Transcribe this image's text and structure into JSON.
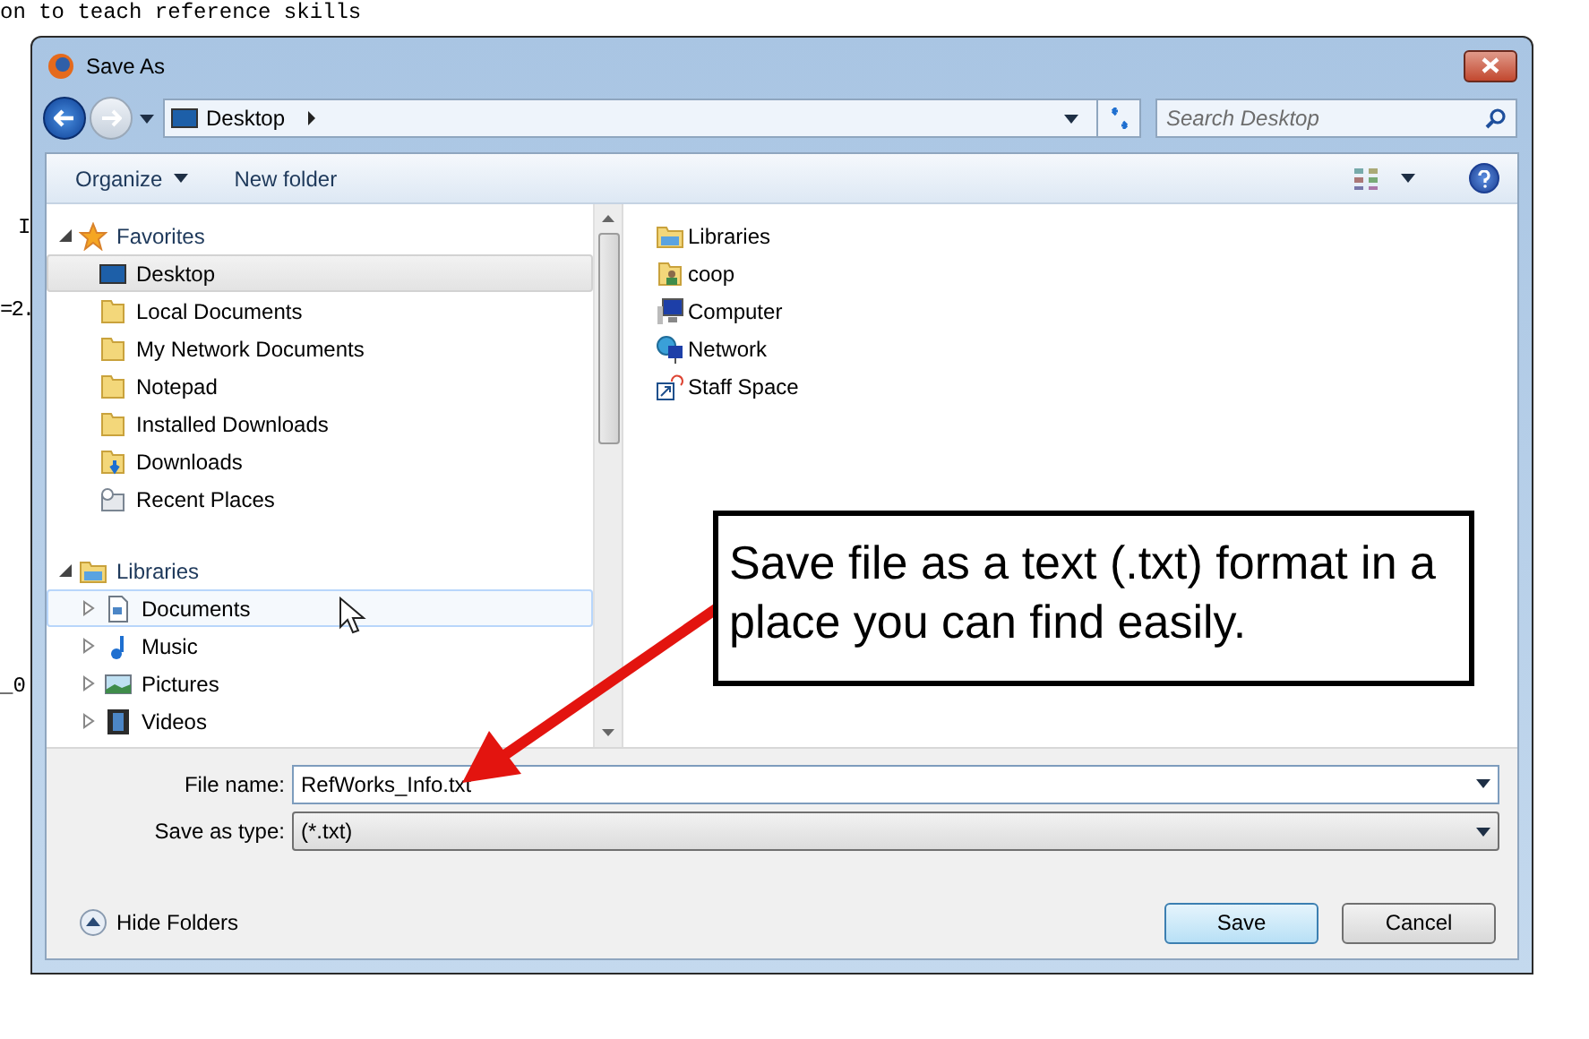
{
  "background_document": {
    "heading_fragment": "on to teach reference skills",
    "margin_fragments": [
      "I",
      "=2.",
      "_0"
    ]
  },
  "window": {
    "title": "Save As"
  },
  "address_bar": {
    "location": "Desktop"
  },
  "search": {
    "placeholder": "Search Desktop"
  },
  "toolbar": {
    "items": [
      {
        "label": "Organize",
        "has_menu": true
      },
      {
        "label": "New folder",
        "has_menu": false
      }
    ]
  },
  "navigation": [
    {
      "label": "Favorites",
      "kind": "favorites",
      "expanded": true,
      "children": [
        {
          "label": "Desktop",
          "kind": "desktop",
          "selected": true,
          "hovered": false
        },
        {
          "label": "Local Documents",
          "kind": "folder",
          "selected": false,
          "hovered": false
        },
        {
          "label": "My Network Documents",
          "kind": "folder",
          "selected": false,
          "hovered": false
        },
        {
          "label": "Notepad",
          "kind": "folder",
          "selected": false,
          "hovered": false
        },
        {
          "label": "Installed Downloads",
          "kind": "folder",
          "selected": false,
          "hovered": false
        },
        {
          "label": "Downloads",
          "kind": "download",
          "selected": false,
          "hovered": false
        },
        {
          "label": "Recent Places",
          "kind": "recent",
          "selected": false,
          "hovered": false
        }
      ]
    },
    {
      "label": "Libraries",
      "kind": "library",
      "expanded": true,
      "children": [
        {
          "label": "Documents",
          "kind": "document",
          "selected": false,
          "hovered": true,
          "expanded": false
        },
        {
          "label": "Music",
          "kind": "music",
          "selected": false,
          "hovered": false,
          "expanded": false
        },
        {
          "label": "Pictures",
          "kind": "picture",
          "selected": false,
          "hovered": false,
          "expanded": false
        },
        {
          "label": "Videos",
          "kind": "video",
          "selected": false,
          "hovered": false,
          "expanded": false
        }
      ]
    }
  ],
  "files": [
    {
      "label": "Libraries",
      "kind": "library"
    },
    {
      "label": "coop",
      "kind": "user"
    },
    {
      "label": "Computer",
      "kind": "computer"
    },
    {
      "label": "Network",
      "kind": "network"
    },
    {
      "label": "Staff Space",
      "kind": "shortcut"
    }
  ],
  "form": {
    "file_name_label": "File name:",
    "file_name": "RefWorks_Info.txt",
    "type_label": "Save as type:",
    "save_as_type": "(*.txt)"
  },
  "footer": {
    "toggle": "Hide Folders",
    "buttons": [
      {
        "label": "Save",
        "default": true
      },
      {
        "label": "Cancel",
        "default": false
      }
    ]
  },
  "callout": {
    "text": "Save file as a text (.txt) format in a place you can find easily."
  }
}
